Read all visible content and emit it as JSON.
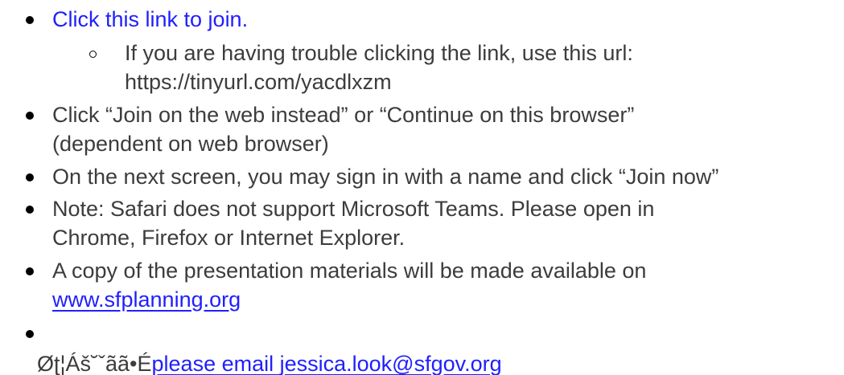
{
  "items": [
    {
      "text": "Click this link to join."
    },
    {
      "text": "If you are having trouble clicking the link, use this url:",
      "text2": "https://tinyurl.com/yacdlxzm"
    },
    {
      "text": "Click “Join on the web instead” or “Continue on this browser”",
      "text2": "(dependent on web browser)"
    },
    {
      "text": "On the next screen, you may sign in with a name and click “Join now”"
    },
    {
      "text": "Note: Safari does not support Microsoft Teams. Please open in",
      "text2": "Chrome, Firefox or Internet Explorer."
    },
    {
      "text": "A copy of the presentation materials will be made available on",
      "link": "www.sfplanning.org"
    },
    {
      "garbled": "Øʈ¦Áš˘ˇãã•É",
      "text": "please email ",
      "link": "jessica.look@sfgov.org"
    }
  ],
  "colors": {
    "text": "#3c3c3c",
    "link": "#1f1fff",
    "bullet": "#000000"
  }
}
